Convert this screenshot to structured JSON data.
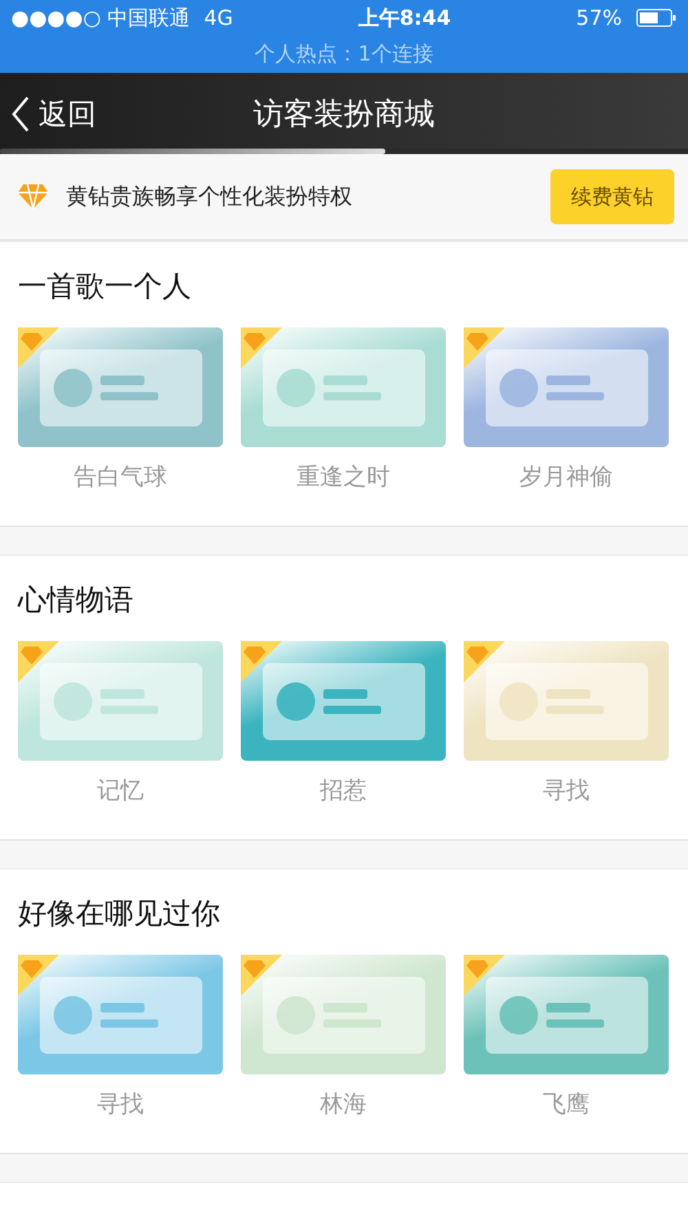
{
  "status_bar": {
    "carrier": "●●●●○ 中国联通",
    "network": "4G",
    "time": "上午8:44",
    "battery": "57%"
  },
  "hotspot": "个人热点：1个连接",
  "nav": {
    "back": "返回",
    "title": "访客装扮商城",
    "progress": {
      "level": 0.56
    }
  },
  "banner": {
    "text": "黄钻贵族畅享个性化装扮特权",
    "button": "续费黄钻"
  },
  "sections": [
    {
      "title": "一首歌一个人",
      "items": [
        {
          "name": "告白气球",
          "vip": true,
          "color": "#8fc3c9"
        },
        {
          "name": "重逢之时",
          "vip": true,
          "color": "#a9ddd3"
        },
        {
          "name": "岁月神偷",
          "vip": true,
          "color": "#9db6e0"
        }
      ]
    },
    {
      "title": "心情物语",
      "items": [
        {
          "name": "记忆",
          "vip": true,
          "color": "#bfe6dc"
        },
        {
          "name": "招惹",
          "vip": true,
          "color": "#3bb4bf"
        },
        {
          "name": "寻找",
          "vip": true,
          "color": "#efe4c2"
        }
      ]
    },
    {
      "title": "好像在哪见过你",
      "items": [
        {
          "name": "寻找",
          "vip": true,
          "color": "#7cc7e6"
        },
        {
          "name": "林海",
          "vip": true,
          "color": "#cfe6cf"
        },
        {
          "name": "飞鹰",
          "vip": true,
          "color": "#6cc2b8"
        }
      ]
    }
  ]
}
